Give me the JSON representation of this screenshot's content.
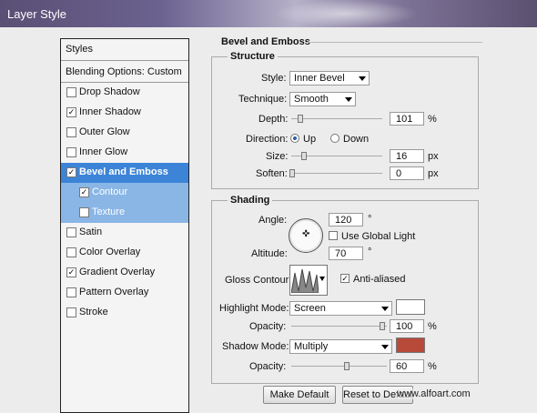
{
  "window": {
    "title": "Layer Style"
  },
  "styles_panel": {
    "header": "Styles",
    "blending": "Blending Options: Custom",
    "items": [
      {
        "label": "Drop Shadow",
        "checked": false
      },
      {
        "label": "Inner Shadow",
        "checked": true
      },
      {
        "label": "Outer Glow",
        "checked": false
      },
      {
        "label": "Inner Glow",
        "checked": false
      },
      {
        "label": "Bevel and Emboss",
        "checked": true
      },
      {
        "label": "Contour",
        "checked": true
      },
      {
        "label": "Texture",
        "checked": false
      },
      {
        "label": "Satin",
        "checked": false
      },
      {
        "label": "Color Overlay",
        "checked": false
      },
      {
        "label": "Gradient Overlay",
        "checked": true
      },
      {
        "label": "Pattern Overlay",
        "checked": false
      },
      {
        "label": "Stroke",
        "checked": false
      }
    ]
  },
  "bevel": {
    "title": "Bevel and Emboss",
    "structure": {
      "title": "Structure",
      "style_label": "Style:",
      "style_value": "Inner Bevel",
      "technique_label": "Technique:",
      "technique_value": "Smooth",
      "depth_label": "Depth:",
      "depth_value": "101",
      "depth_unit": "%",
      "direction_label": "Direction:",
      "dir_up": "Up",
      "dir_down": "Down",
      "size_label": "Size:",
      "size_value": "16",
      "size_unit": "px",
      "soften_label": "Soften:",
      "soften_value": "0",
      "soften_unit": "px"
    },
    "shading": {
      "title": "Shading",
      "angle_label": "Angle:",
      "angle_value": "120",
      "angle_unit": "°",
      "global_light": "Use Global Light",
      "altitude_label": "Altitude:",
      "altitude_value": "70",
      "altitude_unit": "°",
      "gloss_label": "Gloss Contour:",
      "antialiased": "Anti-aliased",
      "highlight_label": "Highlight Mode:",
      "highlight_value": "Screen",
      "highlight_color": "#ffffff",
      "h_opacity_label": "Opacity:",
      "h_opacity_value": "100",
      "h_opacity_unit": "%",
      "shadow_label": "Shadow Mode:",
      "shadow_value": "Multiply",
      "shadow_color": "#b84a3a",
      "s_opacity_label": "Opacity:",
      "s_opacity_value": "60",
      "s_opacity_unit": "%"
    },
    "buttons": {
      "make_default": "Make Default",
      "reset": "Reset to Default"
    }
  },
  "watermark": "www.alfoart.com"
}
